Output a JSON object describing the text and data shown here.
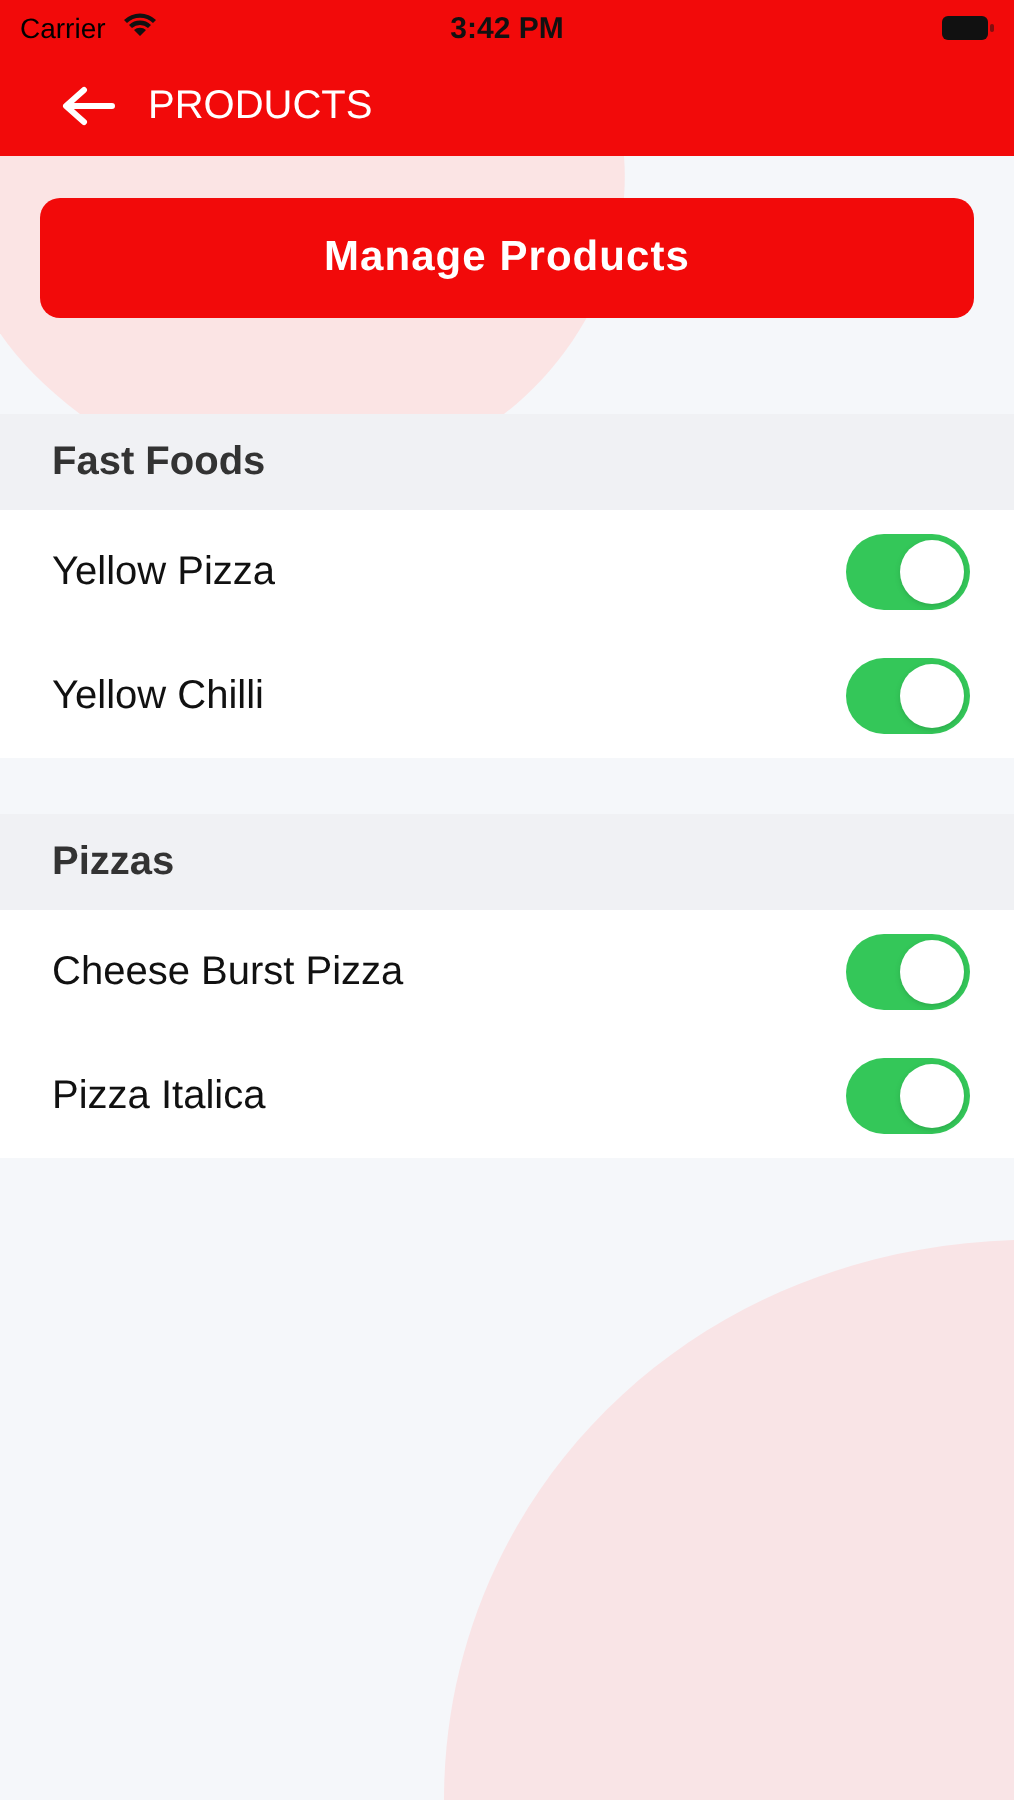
{
  "status_bar": {
    "carrier": "Carrier",
    "time": "3:42 PM"
  },
  "nav_bar": {
    "title": "PRODUCTS"
  },
  "manage_button": {
    "label": "Manage Products"
  },
  "sections": [
    {
      "title": "Fast Foods",
      "items": [
        {
          "name": "Yellow Pizza",
          "on": true
        },
        {
          "name": "Yellow Chilli",
          "on": true
        }
      ]
    },
    {
      "title": "Pizzas",
      "items": [
        {
          "name": "Cheese Burst Pizza",
          "on": true
        },
        {
          "name": "Pizza Italica",
          "on": true
        }
      ]
    }
  ]
}
